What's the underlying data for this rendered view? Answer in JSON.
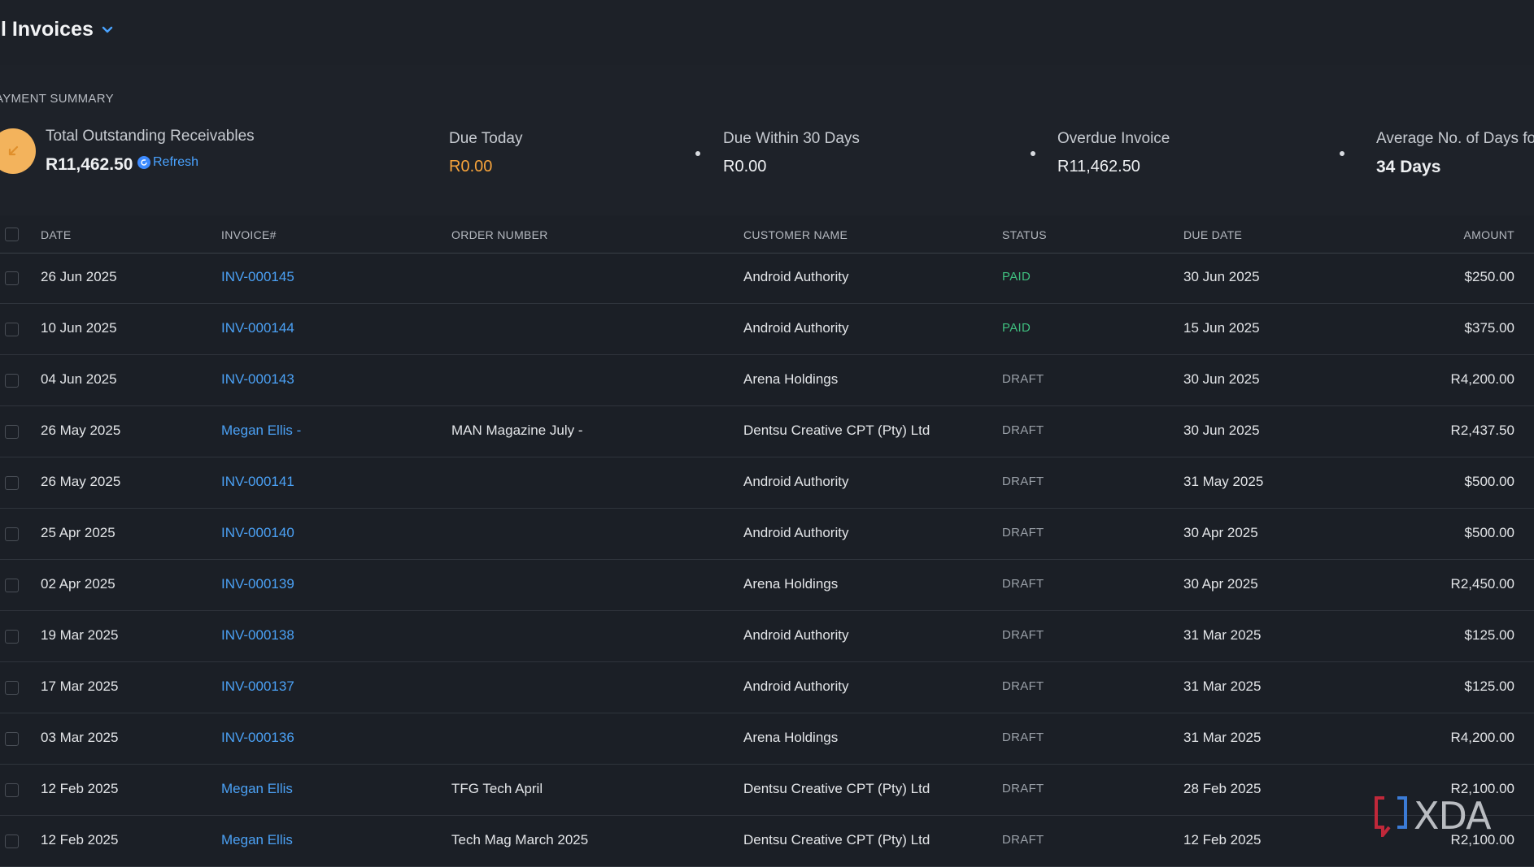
{
  "header": {
    "title": "ll Invoices"
  },
  "summary": {
    "heading": "AYMENT SUMMARY",
    "total_label": "Total Outstanding Receivables",
    "total_value": "R11,462.50",
    "refresh_label": "Refresh",
    "due_today_label": "Due Today",
    "due_today_value": "R0.00",
    "due_30_label": "Due Within 30 Days",
    "due_30_value": "R0.00",
    "overdue_label": "Overdue Invoice",
    "overdue_value": "R11,462.50",
    "avg_days_label": "Average No. of Days for",
    "avg_days_value": "34 Days"
  },
  "table": {
    "columns": {
      "date": "DATE",
      "invoice": "INVOICE#",
      "order": "ORDER NUMBER",
      "customer": "CUSTOMER NAME",
      "status": "STATUS",
      "due": "DUE DATE",
      "amount": "AMOUNT"
    },
    "rows": [
      {
        "date": "26 Jun 2025",
        "invoice": "INV-000145",
        "order": "",
        "customer": "Android Authority",
        "status": "PAID",
        "due": "30 Jun 2025",
        "amount": "$250.00"
      },
      {
        "date": "10 Jun 2025",
        "invoice": "INV-000144",
        "order": "",
        "customer": "Android Authority",
        "status": "PAID",
        "due": "15 Jun 2025",
        "amount": "$375.00"
      },
      {
        "date": "04 Jun 2025",
        "invoice": "INV-000143",
        "order": "",
        "customer": "Arena Holdings",
        "status": "DRAFT",
        "due": "30 Jun 2025",
        "amount": "R4,200.00"
      },
      {
        "date": "26 May 2025",
        "invoice": "Megan Ellis -",
        "order": "MAN Magazine July -",
        "customer": "Dentsu Creative CPT (Pty) Ltd",
        "status": "DRAFT",
        "due": "30 Jun 2025",
        "amount": "R2,437.50"
      },
      {
        "date": "26 May 2025",
        "invoice": "INV-000141",
        "order": "",
        "customer": "Android Authority",
        "status": "DRAFT",
        "due": "31 May 2025",
        "amount": "$500.00"
      },
      {
        "date": "25 Apr 2025",
        "invoice": "INV-000140",
        "order": "",
        "customer": "Android Authority",
        "status": "DRAFT",
        "due": "30 Apr 2025",
        "amount": "$500.00"
      },
      {
        "date": "02 Apr 2025",
        "invoice": "INV-000139",
        "order": "",
        "customer": "Arena Holdings",
        "status": "DRAFT",
        "due": "30 Apr 2025",
        "amount": "R2,450.00"
      },
      {
        "date": "19 Mar 2025",
        "invoice": "INV-000138",
        "order": "",
        "customer": "Android Authority",
        "status": "DRAFT",
        "due": "31 Mar 2025",
        "amount": "$125.00"
      },
      {
        "date": "17 Mar 2025",
        "invoice": "INV-000137",
        "order": "",
        "customer": "Android Authority",
        "status": "DRAFT",
        "due": "31 Mar 2025",
        "amount": "$125.00"
      },
      {
        "date": "03 Mar 2025",
        "invoice": "INV-000136",
        "order": "",
        "customer": "Arena Holdings",
        "status": "DRAFT",
        "due": "31 Mar 2025",
        "amount": "R4,200.00"
      },
      {
        "date": "12 Feb 2025",
        "invoice": "Megan Ellis",
        "order": "TFG Tech April",
        "customer": "Dentsu Creative CPT (Pty) Ltd",
        "status": "DRAFT",
        "due": "28 Feb 2025",
        "amount": "R2,100.00"
      },
      {
        "date": "12 Feb 2025",
        "invoice": "Megan Ellis",
        "order": "Tech Mag March 2025",
        "customer": "Dentsu Creative CPT (Pty) Ltd",
        "status": "DRAFT",
        "due": "12 Feb 2025",
        "amount": "R2,100.00"
      }
    ]
  },
  "status_colors": {
    "PAID": "#3fbf7f",
    "DRAFT": "#9aa0a8"
  },
  "watermark": {
    "text": "XDA"
  }
}
